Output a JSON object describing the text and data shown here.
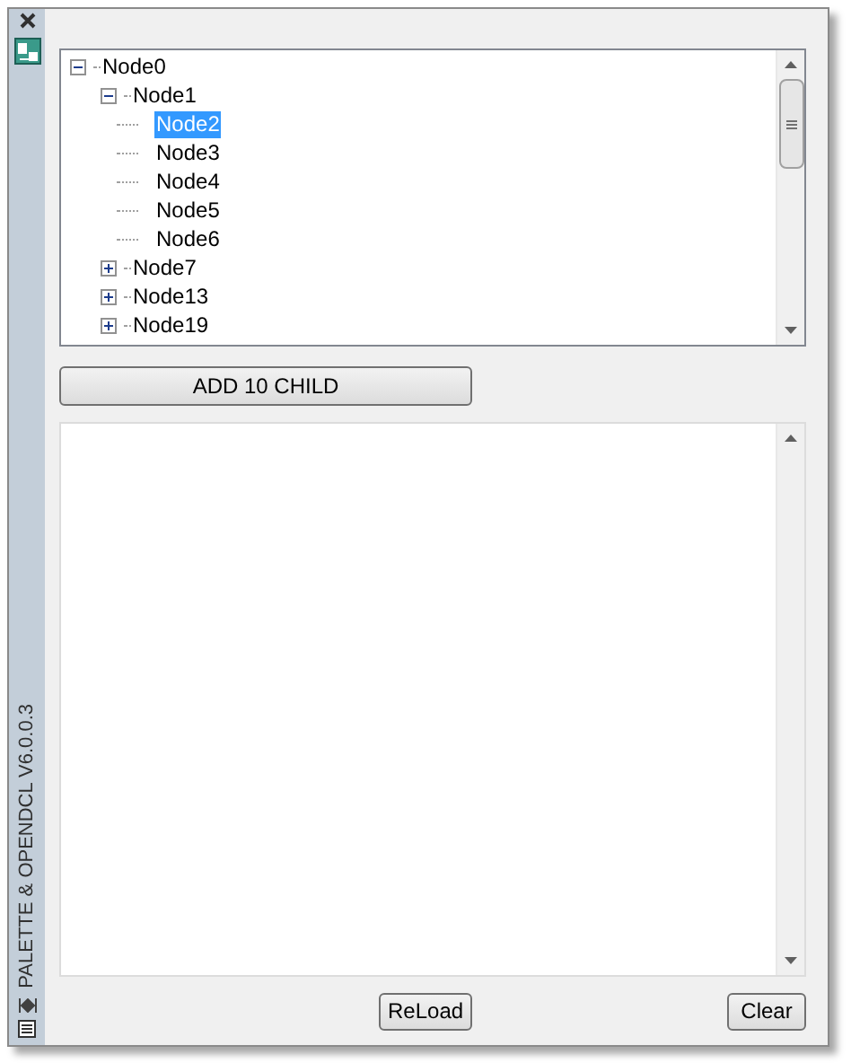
{
  "palette": {
    "title": "PALETTE & OPENDCL V6.0.0.3"
  },
  "tree": {
    "nodes": [
      {
        "label": "Node0",
        "expanded": true,
        "selected": false,
        "children": [
          {
            "label": "Node1",
            "expanded": true,
            "selected": false,
            "children": [
              {
                "label": "Node2",
                "selected": true
              },
              {
                "label": "Node3",
                "selected": false
              },
              {
                "label": "Node4",
                "selected": false
              },
              {
                "label": "Node5",
                "selected": false
              },
              {
                "label": "Node6",
                "selected": false
              }
            ]
          },
          {
            "label": "Node7",
            "expanded": false,
            "selected": false
          },
          {
            "label": "Node13",
            "expanded": false,
            "selected": false
          },
          {
            "label": "Node19",
            "expanded": false,
            "selected": false
          }
        ]
      }
    ]
  },
  "add_button": "ADD 10 CHILD",
  "buttons": [
    "ReLoad",
    "Clear"
  ]
}
